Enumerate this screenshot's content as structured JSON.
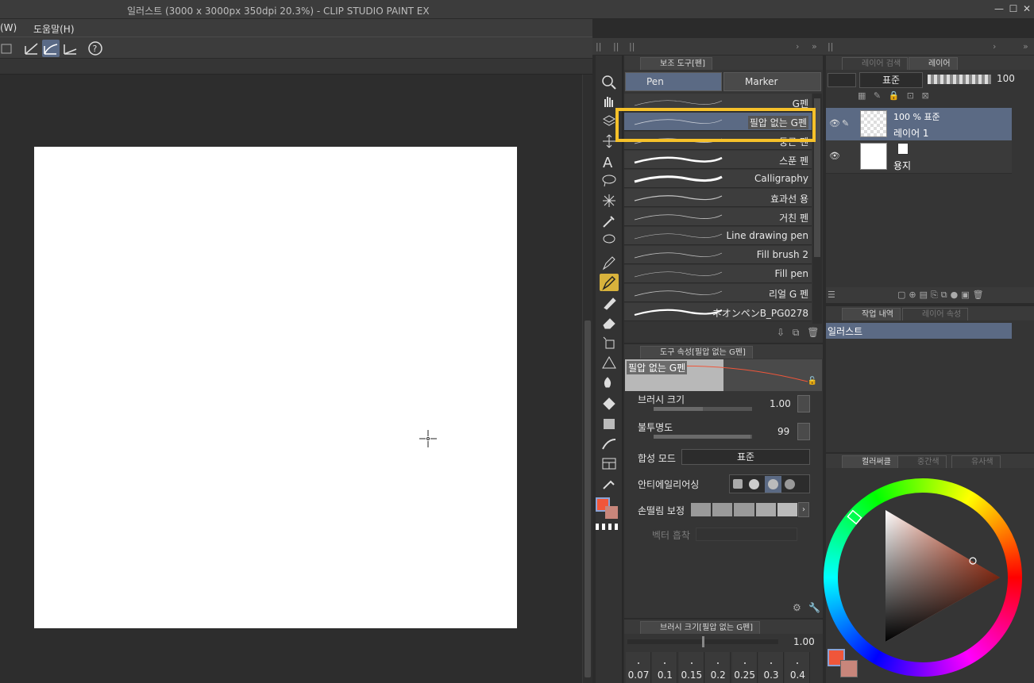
{
  "window": {
    "title": "일러스트 (3000 x 3000px 350dpi 20.3%)  - CLIP STUDIO PAINT EX"
  },
  "menu": {
    "items": [
      "(W)",
      "도움말(H)"
    ]
  },
  "tool_panel": {
    "tab": "보조 도구[펜]",
    "subtab_pen": "Pen",
    "subtab_marker": "Marker"
  },
  "brushes": [
    {
      "label": "G펜"
    },
    {
      "label": "필압 없는 G펜"
    },
    {
      "label": "둥근 펜"
    },
    {
      "label": "스푼 펜"
    },
    {
      "label": "Calligraphy"
    },
    {
      "label": "효과선 용"
    },
    {
      "label": "거친 펜"
    },
    {
      "label": "Line drawing pen"
    },
    {
      "label": "Fill brush 2"
    },
    {
      "label": "Fill pen"
    },
    {
      "label": "리얼 G 펜"
    },
    {
      "label": "ネオンペンB_PG0278"
    }
  ],
  "tool_property": {
    "tab": "도구 속성[필압 없는 G펜]",
    "preview_name": "필압 없는 G펜",
    "brush_size_label": "브러시 크기",
    "brush_size_value": "1.00",
    "opacity_label": "불투명도",
    "opacity_value": "99",
    "blend_label": "합성 모드",
    "blend_value": "표준",
    "antialias_label": "안티에일리어싱",
    "stabilize_label": "손떨림 보정",
    "vector_label": "벡터 흡착"
  },
  "brush_size_panel": {
    "tab": "브러시 크기[필압 없는 G펜]",
    "value": "1.00",
    "presets": [
      "0.07",
      "0.1",
      "0.15",
      "0.2",
      "0.25",
      "0.3",
      "0.4"
    ]
  },
  "layer_panel": {
    "tab_search": "레이어 검색",
    "tab_layer": "레이어",
    "blend_mode": "표준",
    "opacity": "100",
    "layers": [
      {
        "line1": "100 % 표준",
        "line2": "레이어 1"
      },
      {
        "line1": "",
        "line2": "용지"
      }
    ]
  },
  "history_panel": {
    "tab": "작업 내역",
    "tab2": "레이어 속성",
    "items": [
      "일러스트"
    ]
  },
  "color_panel": {
    "tab": "컬러써클",
    "tab2": "중간색",
    "tab3": "유사색"
  },
  "colors": {
    "main": "#f0563a",
    "sub": "#c8867b",
    "accent": "#f6c12a",
    "selected": "#5b6a84"
  }
}
